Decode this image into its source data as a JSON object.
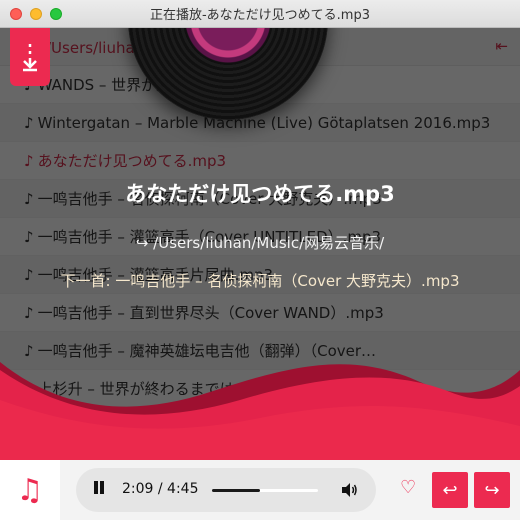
{
  "window": {
    "title": "正在播放-あなただけ见つめてる.mp3"
  },
  "playlist": {
    "path": "/Users/liuhan/Music/网易云音乐/",
    "items": [
      {
        "note": "♪",
        "label": "WANDS – 世界が終るまでは….mp3"
      },
      {
        "note": "♪",
        "label": "Wintergatan – Marble Machine (Live) Götaplatsen 2016.mp3"
      },
      {
        "note": "♪",
        "label": "あなただけ见つめてる.mp3"
      },
      {
        "note": "♪",
        "label": "一鸣吉他手 – 名侦探柯南（Cover 大野克夫）.mp3"
      },
      {
        "note": "♪",
        "label": "一鸣吉他手 – 灌篮高手（Cover UNTITLED）.mp3"
      },
      {
        "note": "♪",
        "label": "一鸣吉他手 – 灌篮高手片尾曲.mp3"
      },
      {
        "note": "♪",
        "label": "一鸣吉他手 – 直到世界尽头（Cover WAND）.mp3"
      },
      {
        "note": "♪",
        "label": "一鸣吉他手 – 魔神英雄坛电吉他（翻弹）（Cover…"
      },
      {
        "note": "♪",
        "label": "上杉升 – 世界が終わるまでは.mp3"
      }
    ]
  },
  "now_playing": {
    "title": "あなただけ见つめてる.mp3",
    "path_arrow": "↪",
    "path": "/Users/liuhan/Music/网易云音乐/",
    "next_label": "下一首: 一鸣吉他手 – 名侦探柯南（Cover 大野克夫）.mp3"
  },
  "player": {
    "time": "2:09 / 4:45",
    "progress": 0.452,
    "icons": {
      "music": "music-note-icon",
      "pause": "pause-icon",
      "volume": "volume-icon",
      "heart": "heart-icon",
      "prev": "return-icon",
      "next": "redo-icon",
      "download": "download-icon",
      "collapse": "collapse-left-icon"
    }
  },
  "colors": {
    "accent": "#ec2a50",
    "wave": "#e4234a",
    "wave_dark": "#9e1030"
  }
}
